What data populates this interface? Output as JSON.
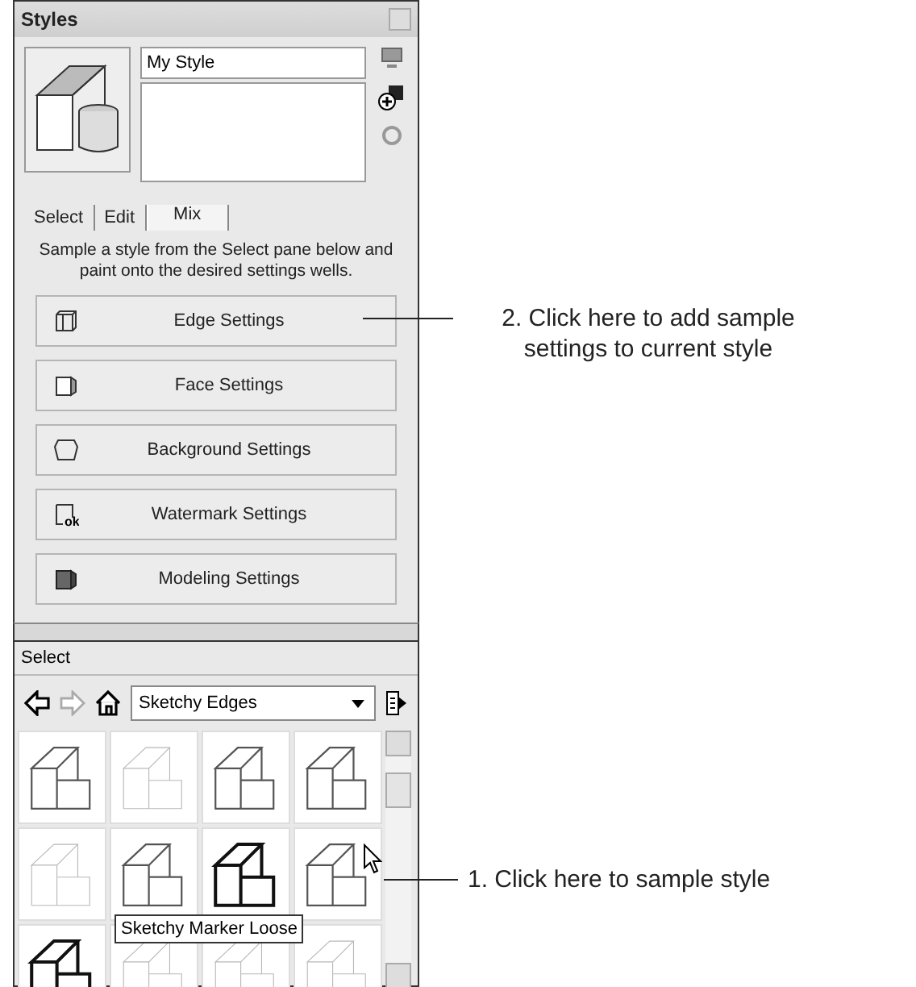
{
  "window": {
    "title": "Styles"
  },
  "style": {
    "name": "My Style"
  },
  "tabs": [
    {
      "label": "Select",
      "selected": false
    },
    {
      "label": "Edit",
      "selected": false
    },
    {
      "label": "Mix",
      "selected": true
    }
  ],
  "instructions": "Sample a style from the Select pane below and paint onto the desired settings wells.",
  "settings_buttons": [
    {
      "label": "Edge Settings",
      "kind": "edge"
    },
    {
      "label": "Face Settings",
      "kind": "face"
    },
    {
      "label": "Background Settings",
      "kind": "background"
    },
    {
      "label": "Watermark Settings",
      "kind": "watermark",
      "icon_text": "ok"
    },
    {
      "label": "Modeling Settings",
      "kind": "modeling"
    }
  ],
  "select_pane": {
    "title": "Select",
    "collection": "Sketchy Edges",
    "thumbnails": [
      {
        "kind": "normal"
      },
      {
        "kind": "faint"
      },
      {
        "kind": "normal"
      },
      {
        "kind": "normal"
      },
      {
        "kind": "faint"
      },
      {
        "kind": "normal"
      },
      {
        "kind": "bold"
      },
      {
        "kind": "normal"
      },
      {
        "kind": "bold"
      },
      {
        "kind": "faint"
      },
      {
        "kind": "faint"
      },
      {
        "kind": "faint"
      }
    ],
    "tooltip": "Sketchy Marker Loose"
  },
  "callouts": [
    {
      "text": "2. Click here to add sample settings to current style"
    },
    {
      "text": "1. Click here to sample style"
    }
  ]
}
